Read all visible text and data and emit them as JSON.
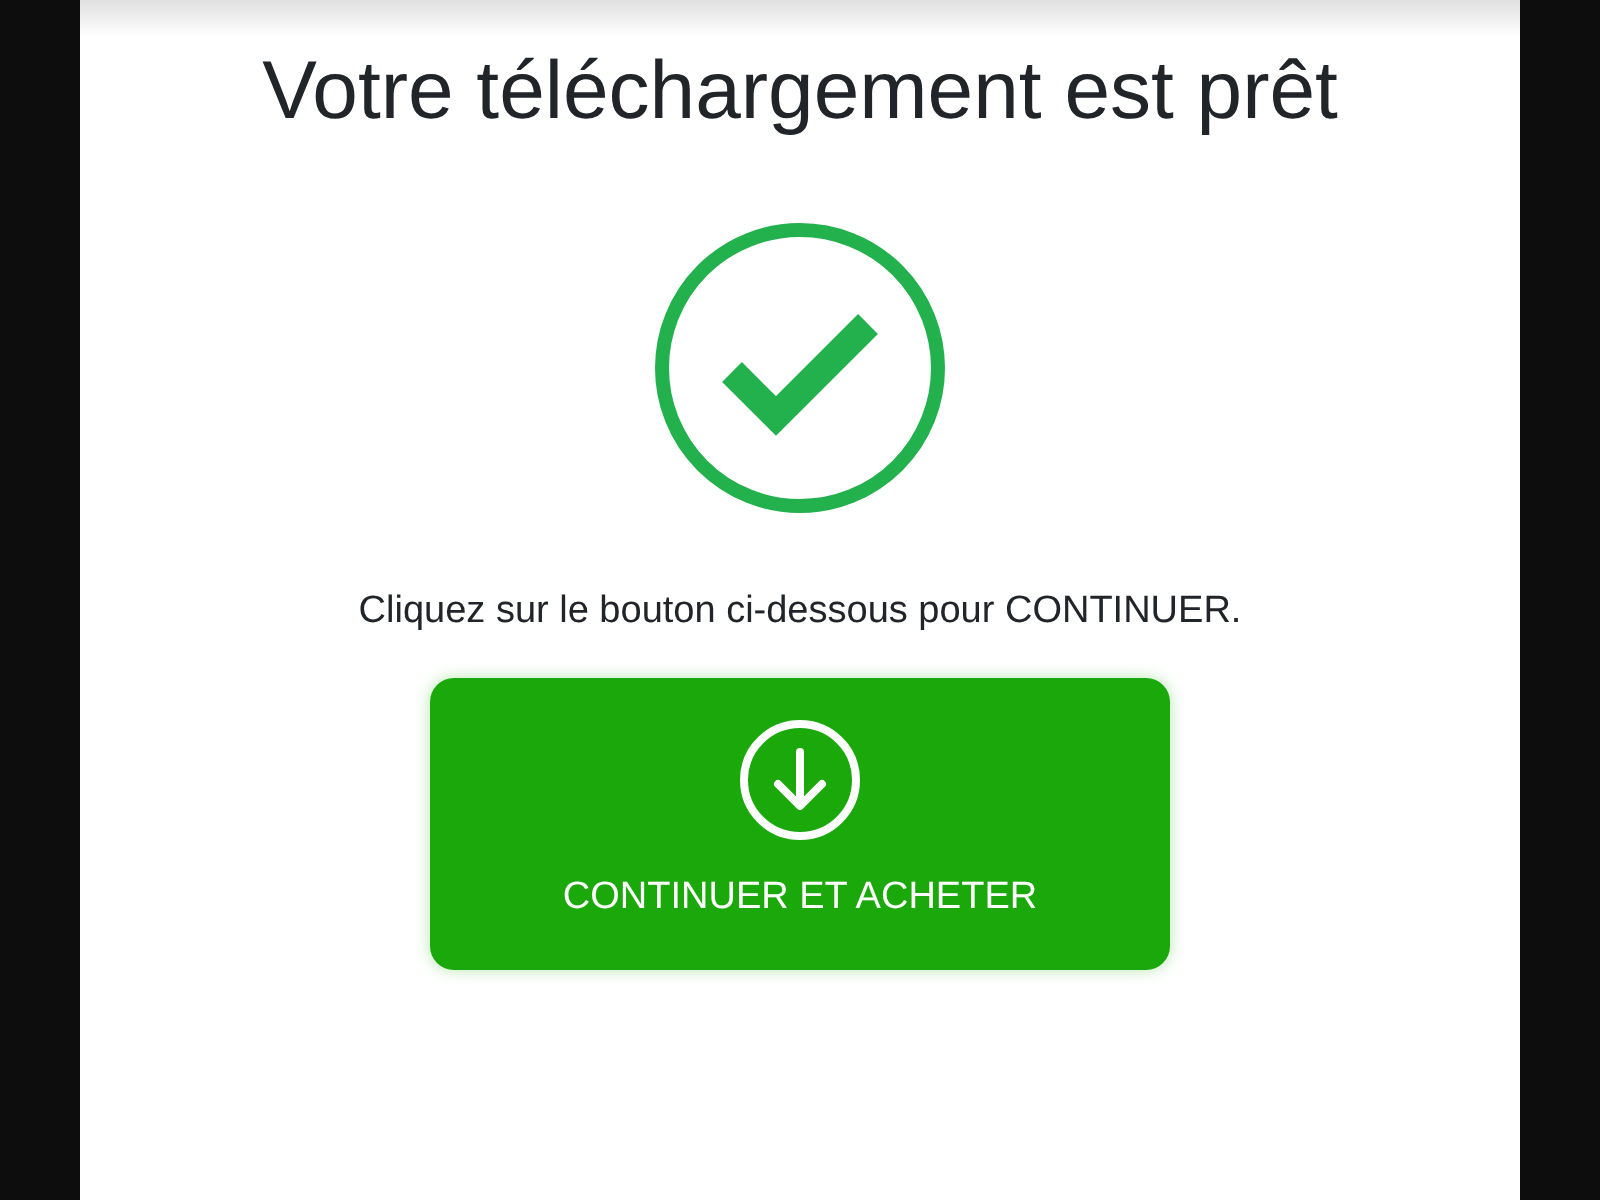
{
  "title": "Votre téléchargement est prêt",
  "message": "Cliquez sur le bouton ci-dessous pour CONTINUER.",
  "button": {
    "label": "CONTINUER ET ACHETER"
  }
}
